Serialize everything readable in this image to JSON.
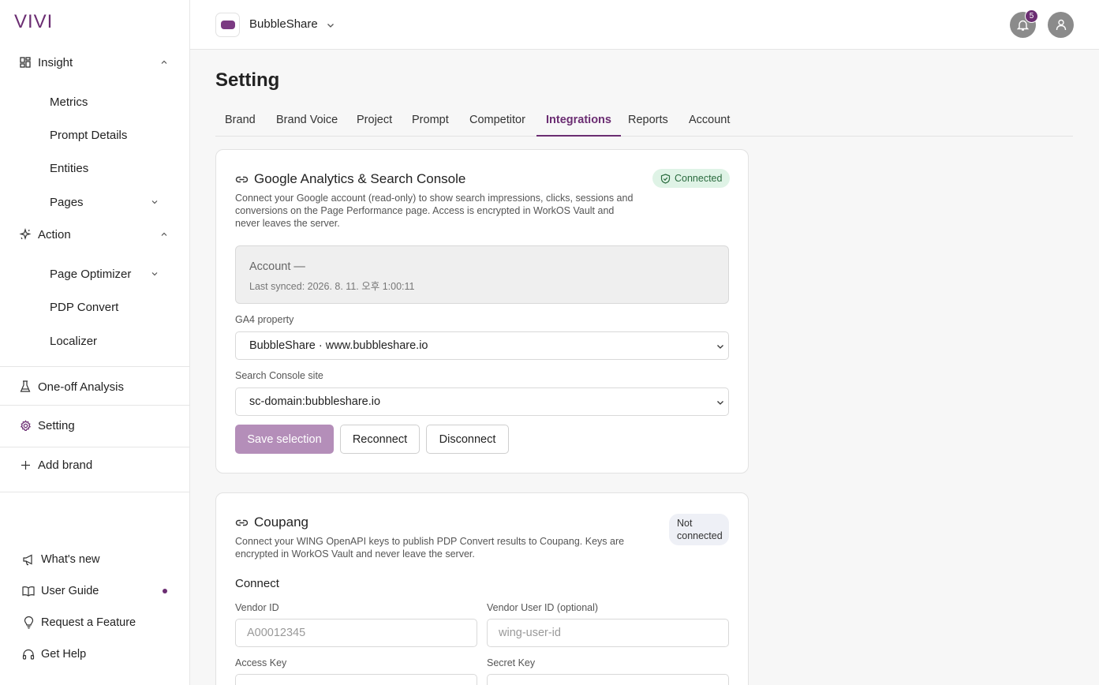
{
  "sidebar": {
    "logo": "VIVI",
    "insight": {
      "label": "Insight",
      "items": [
        "Metrics",
        "Prompt Details",
        "Entities",
        "Pages"
      ]
    },
    "action": {
      "label": "Action",
      "items": [
        "Page Optimizer",
        "PDP Convert",
        "Localizer"
      ]
    },
    "one_off": "One-off Analysis",
    "setting": "Setting",
    "add_brand": "Add brand",
    "footer": [
      "What's new",
      "User Guide",
      "Request a Feature",
      "Get Help"
    ]
  },
  "topbar": {
    "brand": "BubbleShare",
    "notification_count": "5"
  },
  "page": {
    "title": "Setting"
  },
  "tabs": [
    "Brand",
    "Brand Voice",
    "Project",
    "Prompt",
    "Competitor",
    "Integrations",
    "Reports",
    "Account"
  ],
  "active_tab": "Integrations",
  "google": {
    "title": "Google Analytics & Search Console",
    "status": "Connected",
    "description": "Connect your Google account (read-only) to show search impressions, clicks, sessions and conversions on the Page Performance page. Access is encrypted in WorkOS Vault and never leaves the server.",
    "account": "Account —",
    "last_synced": "Last synced: 2026. 8. 11. 오후 1:00:11",
    "ga4_label": "GA4 property",
    "ga4_value": "BubbleShare · www.bubbleshare.io",
    "gsc_label": "Search Console site",
    "gsc_value": "sc-domain:bubbleshare.io",
    "save": "Save selection",
    "reconnect": "Reconnect",
    "disconnect": "Disconnect"
  },
  "coupang": {
    "title": "Coupang",
    "status": "Not connected",
    "description": "Connect your WING OpenAPI keys to publish PDP Convert results to Coupang. Keys are encrypted in WorkOS Vault and never leave the server.",
    "connect": "Connect",
    "vendor_id_label": "Vendor ID",
    "vendor_id_placeholder": "A00012345",
    "vendor_user_label": "Vendor User ID (optional)",
    "vendor_user_placeholder": "wing-user-id",
    "access_key_label": "Access Key",
    "secret_key_label": "Secret Key"
  },
  "colors": {
    "accent": "#6b2d72",
    "accent_light": "#b48eb9",
    "connected_bg": "#dff3e6"
  }
}
